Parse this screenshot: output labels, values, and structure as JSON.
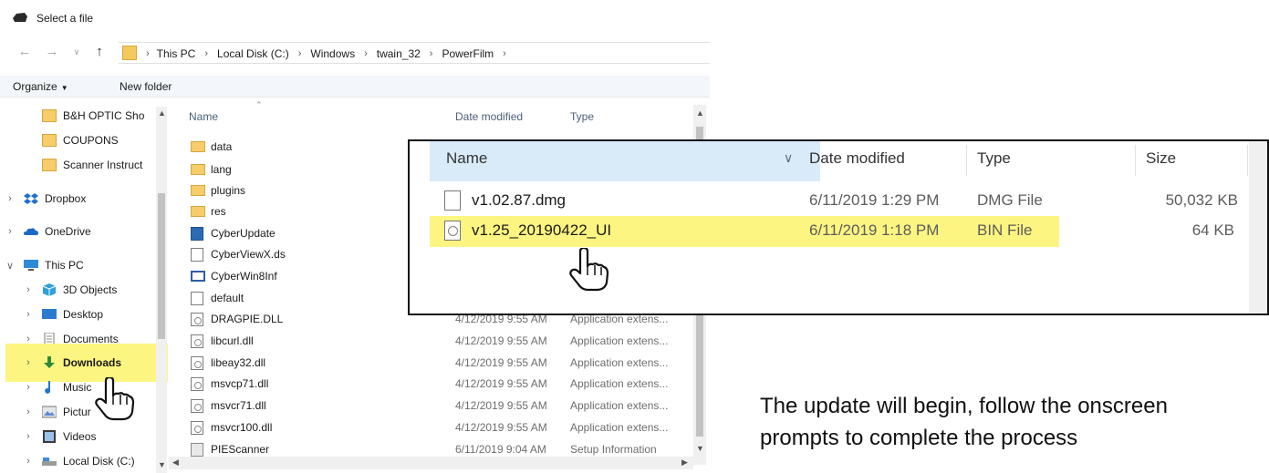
{
  "window": {
    "title": "Select a file"
  },
  "address": {
    "breadcrumbs": [
      "This PC",
      "Local Disk (C:)",
      "Windows",
      "twain_32",
      "PowerFilm"
    ]
  },
  "toolbar": {
    "organize": "Organize",
    "new_folder": "New folder"
  },
  "nav": {
    "quick": [
      {
        "label": "B&H OPTIC Sho"
      },
      {
        "label": "COUPONS"
      },
      {
        "label": "Scanner Instruct"
      }
    ],
    "dropbox": "Dropbox",
    "onedrive": "OneDrive",
    "thispc": "This PC",
    "objects3d": "3D Objects",
    "desktop": "Desktop",
    "documents": "Documents",
    "downloads": "Downloads",
    "music": "Music",
    "pictures": "Pictur",
    "videos": "Videos",
    "localdisk": "Local Disk (C:)"
  },
  "filelist": {
    "columns": {
      "name": "Name",
      "date": "Date modified",
      "type": "Type"
    },
    "rows": [
      {
        "name": "data",
        "date": "",
        "type": ""
      },
      {
        "name": "lang",
        "date": "",
        "type": ""
      },
      {
        "name": "plugins",
        "date": "",
        "type": ""
      },
      {
        "name": "res",
        "date": "",
        "type": ""
      },
      {
        "name": "CyberUpdate",
        "date": "",
        "type": ""
      },
      {
        "name": "CyberViewX.ds",
        "date": "",
        "type": ""
      },
      {
        "name": "CyberWin8Inf",
        "date": "",
        "type": ""
      },
      {
        "name": "default",
        "date": "",
        "type": ""
      },
      {
        "name": "DRAGPIE.DLL",
        "date": "4/12/2019 9:55 AM",
        "type": "Application extens..."
      },
      {
        "name": "libcurl.dll",
        "date": "4/12/2019 9:55 AM",
        "type": "Application extens..."
      },
      {
        "name": "libeay32.dll",
        "date": "4/12/2019 9:55 AM",
        "type": "Application extens..."
      },
      {
        "name": "msvcp71.dll",
        "date": "4/12/2019 9:55 AM",
        "type": "Application extens..."
      },
      {
        "name": "msvcr71.dll",
        "date": "4/12/2019 9:55 AM",
        "type": "Application extens..."
      },
      {
        "name": "msvcr100.dll",
        "date": "4/12/2019 9:55 AM",
        "type": "Application extens..."
      },
      {
        "name": "PIEScanner",
        "date": "6/11/2019 9:04 AM",
        "type": "Setup Information"
      }
    ]
  },
  "zoom": {
    "columns": {
      "name": "Name",
      "date": "Date modified",
      "type": "Type",
      "size": "Size"
    },
    "rows": [
      {
        "name": "v1.02.87.dmg",
        "date": "6/11/2019 1:29 PM",
        "type": "DMG File",
        "size": "50,032 KB"
      },
      {
        "name": "v1.25_20190422_UI",
        "date": "6/11/2019 1:18 PM",
        "type": "BIN File",
        "size": "64 KB"
      }
    ]
  },
  "instruction": "The update will begin, follow the onscreen prompts to complete the process",
  "colors": {
    "highlight": "#fdf581",
    "header_selected": "#d9ebf9",
    "folder": "#f6cd6a"
  }
}
